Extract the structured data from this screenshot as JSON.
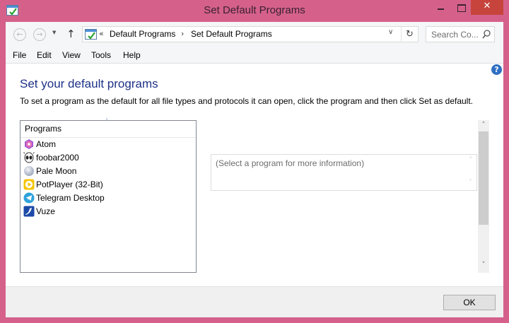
{
  "window": {
    "title": "Set Default Programs",
    "close_glyph": "✕",
    "icon": "control-panel-default-programs-icon"
  },
  "nav": {
    "back_glyph": "←",
    "forward_glyph": "→",
    "recent_glyph": "▼",
    "up_glyph": "↑"
  },
  "address": {
    "prefix": "«",
    "breadcrumb": [
      "Default Programs",
      "Set Default Programs"
    ],
    "separator": "›",
    "dropdown_glyph": "∨",
    "refresh_glyph": "↻"
  },
  "search": {
    "placeholder": "Search Co..."
  },
  "menu": [
    "File",
    "Edit",
    "View",
    "Tools",
    "Help"
  ],
  "help_glyph": "?",
  "heading": "Set your default programs",
  "instructions": "To set a program as the default for all file types and protocols it can open, click the program and then click Set as default.",
  "program_list": {
    "header": "Programs",
    "sort_glyph": "˄",
    "items": [
      {
        "label": "Atom",
        "icon": "atom-icon"
      },
      {
        "label": "foobar2000",
        "icon": "foobar2000-icon"
      },
      {
        "label": "Pale Moon",
        "icon": "pale-moon-icon"
      },
      {
        "label": "PotPlayer (32-Bit)",
        "icon": "potplayer-icon"
      },
      {
        "label": "Telegram Desktop",
        "icon": "telegram-icon"
      },
      {
        "label": "Vuze",
        "icon": "vuze-icon"
      }
    ]
  },
  "info_box": {
    "text": "(Select a program for more information)"
  },
  "scroll": {
    "up_glyph": "˄",
    "down_glyph": "˅"
  },
  "buttons": {
    "ok": "OK"
  },
  "colors": {
    "titlebar": "#d5618b",
    "close": "#c7443c",
    "heading": "#1e3287"
  }
}
